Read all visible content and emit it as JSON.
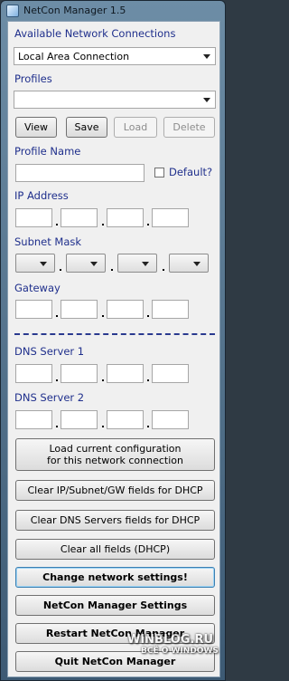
{
  "window": {
    "title": "NetCon Manager 1.5"
  },
  "labels": {
    "available": "Available Network Connections",
    "profiles": "Profiles",
    "profile_name": "Profile Name",
    "default": "Default?",
    "ip": "IP Address",
    "subnet": "Subnet Mask",
    "gateway": "Gateway",
    "dns1": "DNS Server 1",
    "dns2": "DNS Server 2"
  },
  "connection": {
    "selected": "Local Area Connection"
  },
  "profiles": {
    "selected": ""
  },
  "profile_buttons": {
    "view": "View",
    "save": "Save",
    "load": "Load",
    "delete": "Delete"
  },
  "buttons": {
    "load_current_line1": "Load current configuration",
    "load_current_line2": "for this network connection",
    "clear_ip": "Clear IP/Subnet/GW fields for DHCP",
    "clear_dns": "Clear DNS Servers fields for DHCP",
    "clear_all": "Clear all fields (DHCP)",
    "change": "Change network settings!",
    "settings": "NetCon Manager Settings",
    "restart": "Restart NetCon Manager",
    "quit": "Quit NetCon Manager"
  },
  "watermark": {
    "site": "WINBLOG.RU",
    "sub": "ВСЁ О WINDOWS"
  }
}
